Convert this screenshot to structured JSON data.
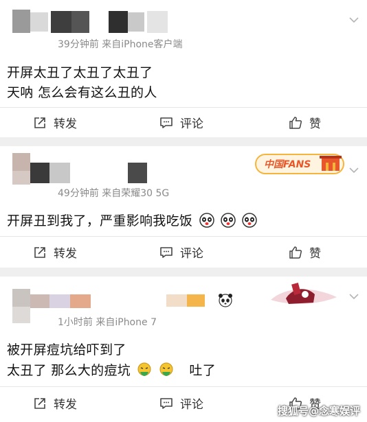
{
  "comments": [
    {
      "meta": "39分钟前  来自iPhone客户端",
      "lines": [
        "开屏太丑了太丑了太丑了",
        "天呐 怎么会有这么丑的人"
      ]
    },
    {
      "meta": "49分钟前  来自荣耀30 5G",
      "badge_text": "中国FANS",
      "lines": [
        "开屏丑到我了，严重影响我吃饭"
      ]
    },
    {
      "meta": "1小时前  来自iPhone 7",
      "lines": [
        "被开屏痘坑给吓到了",
        "太丑了  那么大的痘坑",
        "吐了"
      ]
    }
  ],
  "actions": {
    "repost": "转发",
    "comment": "评论",
    "like": "赞"
  },
  "watermark": "搜狐号@念寒娱评",
  "icons": {
    "repost": "share-icon",
    "comment": "comment-icon",
    "like": "thumbs-up-icon",
    "more": "chevron-down-icon",
    "emoji_panda": "panda-emoji-icon",
    "emoji_vomit": "vomit-emoji-icon"
  },
  "colors": {
    "meta_gray": "#8a8a8a",
    "badge_orange": "#e8572a",
    "badge_gold": "#f5b53d"
  }
}
